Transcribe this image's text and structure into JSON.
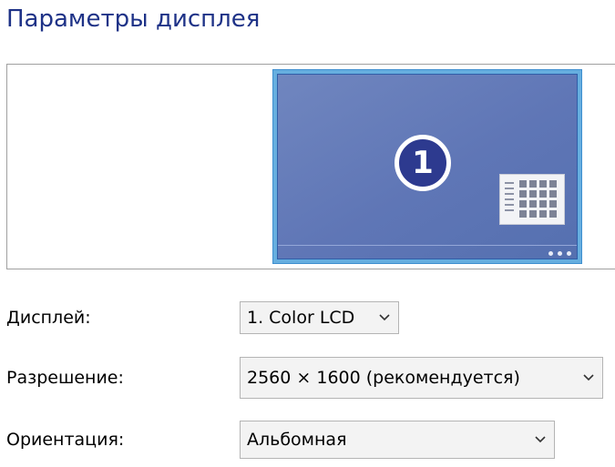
{
  "page": {
    "title": "Параметры дисплея"
  },
  "preview": {
    "monitor_number": "1",
    "screen_color": "#6278b8",
    "frame_color": "#66aedf",
    "badge_color": "#2d3a8f"
  },
  "form": {
    "display": {
      "label": "Дисплей:",
      "value": "1. Color LCD",
      "icon": "chevron-down-icon"
    },
    "resolution": {
      "label": "Разрешение:",
      "value": "2560 × 1600 (рекомендуется)",
      "icon": "chevron-down-icon"
    },
    "orientation": {
      "label": "Ориентация:",
      "value": "Альбомная",
      "icon": "chevron-down-icon"
    }
  },
  "colors": {
    "title": "#1e3287",
    "select_background": "#f3f3f3",
    "select_border": "#b4b4b4"
  }
}
